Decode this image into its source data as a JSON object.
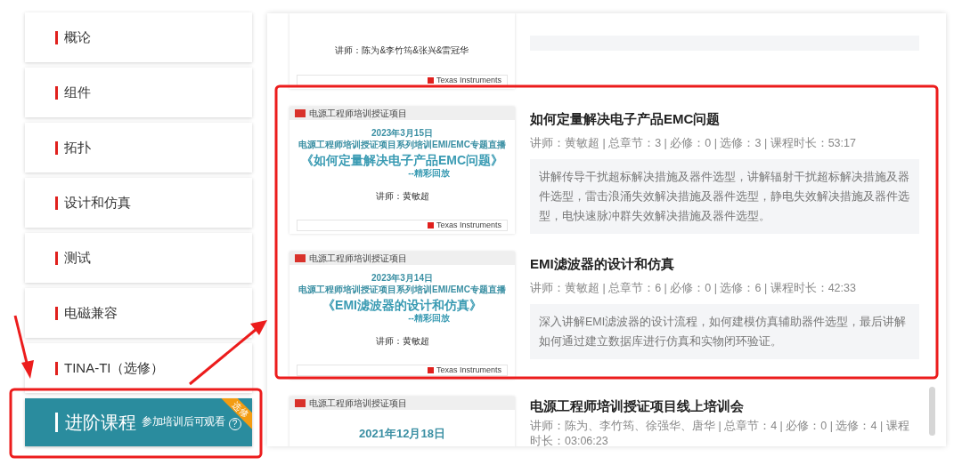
{
  "sidebar": {
    "items": [
      {
        "label": "概论",
        "selected": false
      },
      {
        "label": "组件",
        "selected": false
      },
      {
        "label": "拓扑",
        "selected": false
      },
      {
        "label": "设计和仿真",
        "selected": false
      },
      {
        "label": "测试",
        "selected": false
      },
      {
        "label": "电磁兼容",
        "selected": false
      },
      {
        "label": "TINA-TI（选修）",
        "selected": false
      },
      {
        "label": "进阶课程",
        "note": "参加培训后可观看",
        "help": "?",
        "ribbon": "选修",
        "selected": true
      }
    ]
  },
  "courses": [
    {
      "kind": "partial",
      "thumbnail": {
        "speaker": "讲师：陈为&李竹筠&张兴&雷冠华",
        "footer": "Texas Instruments"
      }
    },
    {
      "kind": "full",
      "title": "如何定量解决电子产品EMC问题",
      "meta": "讲师：黄敏超 | 总章节：3 | 必修：0 | 选修：3 | 课程时长：53:17",
      "description": "讲解传导干扰超标解决措施及器件选型，讲解辐射干扰超标解决措施及器件选型，雷击浪涌失效解决措施及器件选型，静电失效解决措施及器件选型，电快速脉冲群失效解决措施及器件选型。",
      "thumbnail": {
        "header": "电源工程师培训授证项目",
        "date": "2023年3月15日",
        "series": "电源工程师培训授证项目系列培训EMI/EMC专题直播",
        "title": "《如何定量解决电子产品EMC问题》",
        "subtitle": "--精彩回放",
        "speaker": "讲师：黄敏超",
        "footer": "Texas Instruments"
      }
    },
    {
      "kind": "full",
      "title": "EMI滤波器的设计和仿真",
      "meta": "讲师：黄敏超 | 总章节：6 | 必修：0 | 选修：6 | 课程时长：42:33",
      "description": "深入讲解EMI滤波器的设计流程，如何建模仿真辅助器件选型，最后讲解如何通过建立数据库进行仿真和实物闭环验证。",
      "thumbnail": {
        "header": "电源工程师培训授证项目",
        "date": "2023年3月14日",
        "series": "电源工程师培训授证项目系列培训EMI/EMC专题直播",
        "title": "《EMI滤波器的设计和仿真》",
        "subtitle": "--精彩回放",
        "speaker": "讲师：黄敏超",
        "footer": "Texas Instruments"
      }
    },
    {
      "kind": "cut",
      "title": "电源工程师培训授证项目线上培训会",
      "meta": "讲师：陈为、李竹筠、徐强华、唐华 | 总章节：4 | 必修：0 | 选修：4 | 课程时长：03:06:23",
      "thumbnail": {
        "header": "电源工程师培训授证项目",
        "date": "2021年12月18日"
      }
    }
  ]
}
